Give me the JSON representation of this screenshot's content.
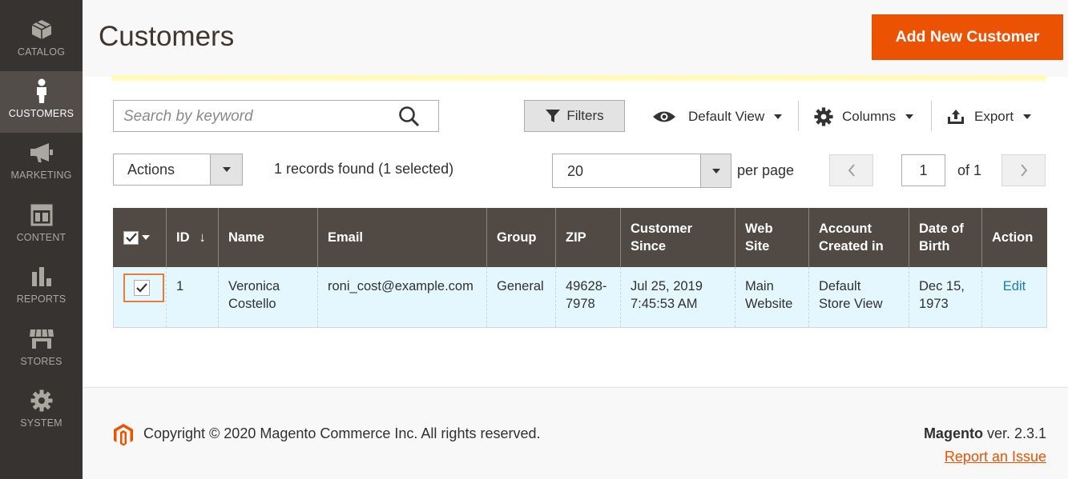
{
  "sidebar": {
    "items": [
      {
        "label": "CATALOG",
        "icon": "box-icon",
        "active": false
      },
      {
        "label": "CUSTOMERS",
        "icon": "person-icon",
        "active": true
      },
      {
        "label": "MARKETING",
        "icon": "megaphone-icon",
        "active": false
      },
      {
        "label": "CONTENT",
        "icon": "layout-icon",
        "active": false
      },
      {
        "label": "REPORTS",
        "icon": "bar-chart-icon",
        "active": false
      },
      {
        "label": "STORES",
        "icon": "storefront-icon",
        "active": false
      },
      {
        "label": "SYSTEM",
        "icon": "gear-icon",
        "active": false
      }
    ]
  },
  "header": {
    "title": "Customers",
    "add_button": "Add New Customer"
  },
  "toolbar": {
    "search_placeholder": "Search by keyword",
    "filters_label": "Filters",
    "view_label": "Default View",
    "columns_label": "Columns",
    "export_label": "Export"
  },
  "grid_controls": {
    "actions_label": "Actions",
    "records_found": "1 records found (1 selected)",
    "per_page_value": "20",
    "per_page_label": "per page",
    "current_page": "1",
    "page_of": "of 1"
  },
  "table": {
    "headers": {
      "id": "ID",
      "sort_arrow": "↓",
      "name": "Name",
      "email": "Email",
      "group": "Group",
      "zip": "ZIP",
      "customer_since_1": "Customer",
      "customer_since_2": "Since",
      "web_site_1": "Web",
      "web_site_2": "Site",
      "account_created_1": "Account",
      "account_created_2": "Created in",
      "dob_1": "Date of",
      "dob_2": "Birth",
      "action": "Action"
    },
    "rows": [
      {
        "id": "1",
        "name_1": "Veronica",
        "name_2": "Costello",
        "email": "roni_cost@example.com",
        "group": "General",
        "zip_1": "49628-",
        "zip_2": "7978",
        "since_1": "Jul 25, 2019",
        "since_2": "7:45:53 AM",
        "site_1": "Main",
        "site_2": "Website",
        "created_1": "Default",
        "created_2": "Store View",
        "dob_1": "Dec 15,",
        "dob_2": "1973",
        "action": "Edit",
        "selected": true
      }
    ]
  },
  "footer": {
    "copyright": "Copyright © 2020 Magento Commerce Inc. All rights reserved.",
    "brand": "Magento",
    "version": " ver. 2.3.1",
    "report_link": "Report an Issue"
  },
  "colors": {
    "accent": "#eb5202",
    "sidebar_bg": "#373330",
    "sidebar_active": "#524d49",
    "table_header": "#514943",
    "row_selected": "#e5f7fe",
    "link": "#1979c3"
  }
}
